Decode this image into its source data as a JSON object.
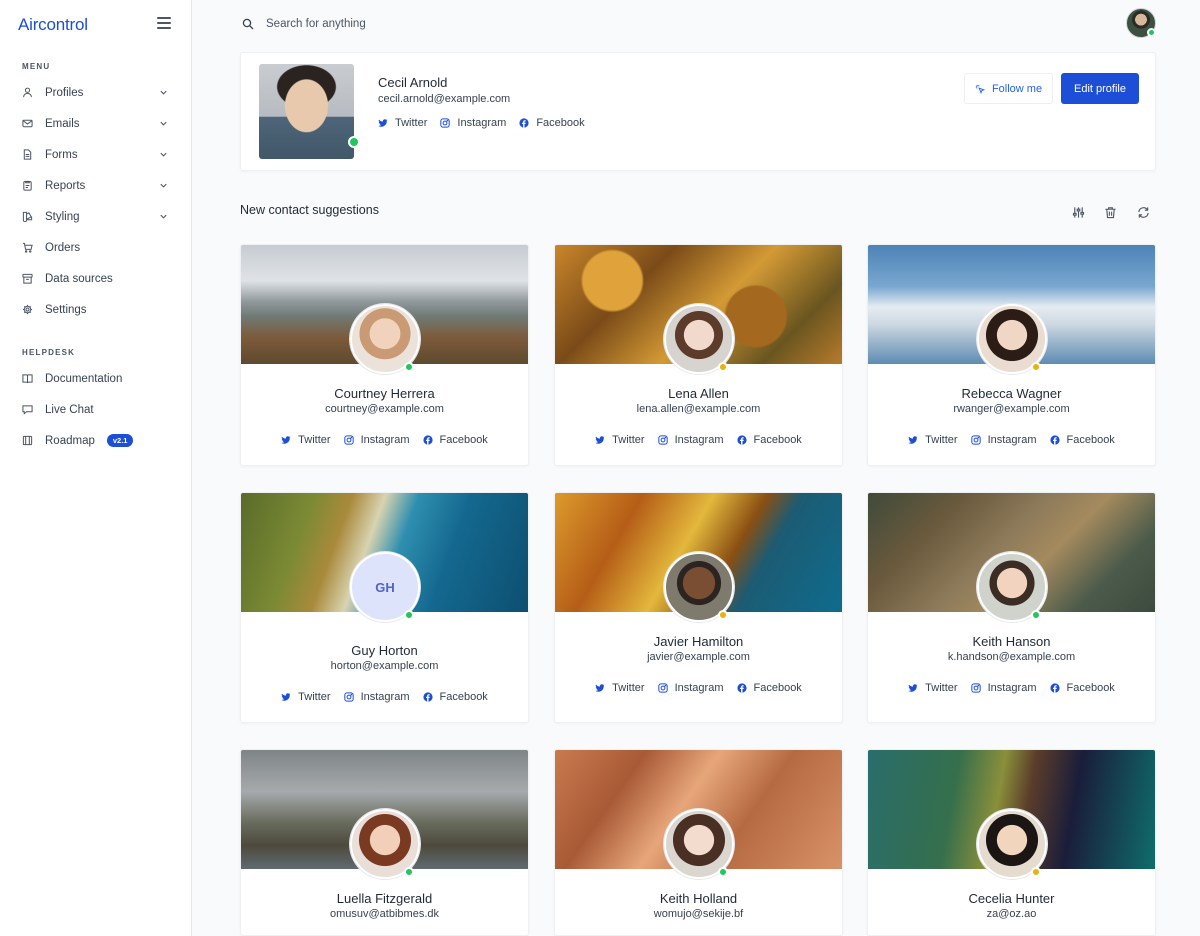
{
  "app": {
    "brand": "Aircontrol"
  },
  "sidebar": {
    "menu_label": "MENU",
    "items": [
      {
        "label": "Profiles",
        "icon": "user-icon",
        "has_chevron": true
      },
      {
        "label": "Emails",
        "icon": "mail-icon",
        "has_chevron": true
      },
      {
        "label": "Forms",
        "icon": "document-icon",
        "has_chevron": true
      },
      {
        "label": "Reports",
        "icon": "clipboard-icon",
        "has_chevron": true
      },
      {
        "label": "Styling",
        "icon": "swatch-icon",
        "has_chevron": true
      },
      {
        "label": "Orders",
        "icon": "cart-icon",
        "has_chevron": false
      },
      {
        "label": "Data sources",
        "icon": "archive-icon",
        "has_chevron": false
      },
      {
        "label": "Settings",
        "icon": "gear-icon",
        "has_chevron": false
      }
    ],
    "helpdesk_label": "HELPDESK",
    "helpdesk_items": [
      {
        "label": "Documentation",
        "icon": "book-icon"
      },
      {
        "label": "Live Chat",
        "icon": "chat-icon"
      },
      {
        "label": "Roadmap",
        "icon": "map-icon",
        "badge": "v2.1"
      }
    ]
  },
  "search": {
    "placeholder": "Search for anything"
  },
  "profile": {
    "name": "Cecil Arnold",
    "email": "cecil.arnold@example.com",
    "social": [
      "Twitter",
      "Instagram",
      "Facebook"
    ],
    "follow_label": "Follow me",
    "edit_label": "Edit profile",
    "status": "online"
  },
  "suggestions": {
    "title": "New contact suggestions",
    "contacts": [
      {
        "name": "Courtney Herrera",
        "email": "courtney@example.com",
        "status": "online",
        "initials": ""
      },
      {
        "name": "Lena Allen",
        "email": "lena.allen@example.com",
        "status": "away",
        "initials": ""
      },
      {
        "name": "Rebecca Wagner",
        "email": "rwanger@example.com",
        "status": "away",
        "initials": ""
      },
      {
        "name": "Guy Horton",
        "email": "horton@example.com",
        "status": "online",
        "initials": "GH"
      },
      {
        "name": "Javier Hamilton",
        "email": "javier@example.com",
        "status": "away",
        "initials": ""
      },
      {
        "name": "Keith Hanson",
        "email": "k.handson@example.com",
        "status": "online",
        "initials": ""
      },
      {
        "name": "Luella Fitzgerald",
        "email": "omusuv@atbibmes.dk",
        "status": "online",
        "initials": ""
      },
      {
        "name": "Keith Holland",
        "email": "womujo@sekije.bf",
        "status": "online",
        "initials": ""
      },
      {
        "name": "Cecelia Hunter",
        "email": "za@oz.ao",
        "status": "away",
        "initials": ""
      }
    ],
    "social": [
      "Twitter",
      "Instagram",
      "Facebook"
    ]
  },
  "colors": {
    "accent": "#1d4ed8",
    "online": "#22c55e",
    "away": "#eab308"
  }
}
